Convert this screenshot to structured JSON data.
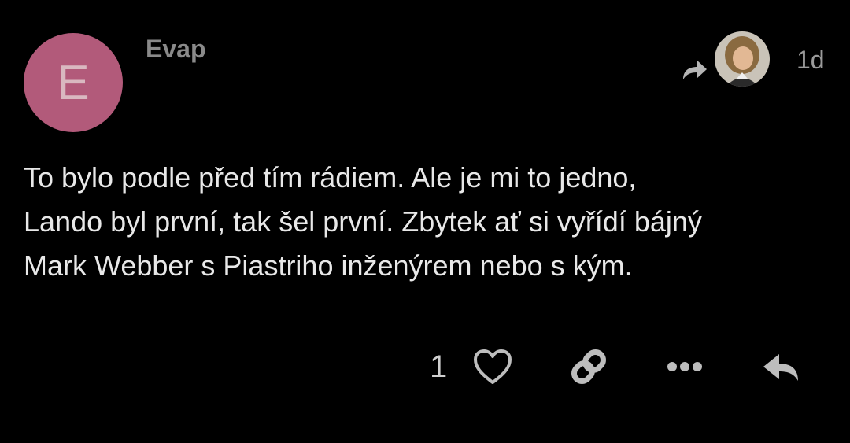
{
  "post": {
    "author": "Evap",
    "avatar_letter": "E",
    "avatar_color": "#b25a7a",
    "date": "1d",
    "reply_to_icon": "reply-arrow-icon",
    "reply_to_avatar": "user-avatar-photo",
    "body_lines": [
      "To bylo podle před tím rádiem. Ale je mi to jedno,",
      "Lando byl první, tak šel první. Zbytek ať si vyřídí bájný",
      "Mark Webber s Piastriho inženýrem nebo s kým."
    ]
  },
  "actions": {
    "like_count": "1",
    "like_icon": "heart-icon",
    "link_icon": "link-icon",
    "more_icon": "more-dots-icon",
    "reply_icon": "reply-icon",
    "icon_color": "#bdbdbd"
  }
}
